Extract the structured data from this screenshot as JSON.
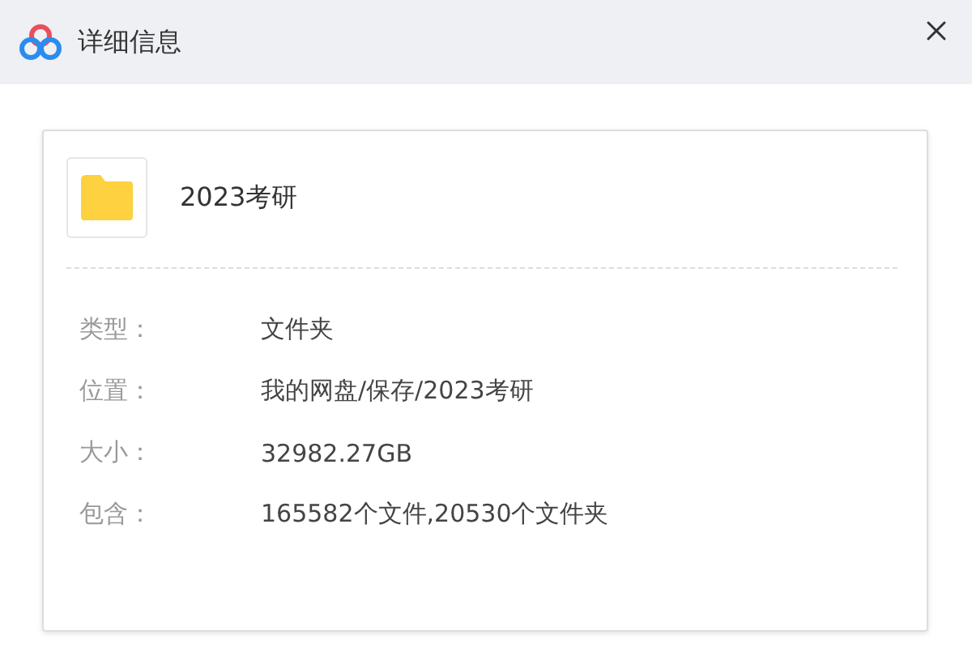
{
  "window": {
    "title": "详细信息"
  },
  "item": {
    "name": "2023考研"
  },
  "details": [
    {
      "label": "类型：",
      "value": "文件夹"
    },
    {
      "label": "位置：",
      "value": "我的网盘/保存/2023考研"
    },
    {
      "label": "大小：",
      "value": "32982.27GB"
    },
    {
      "label": "包含：",
      "value": "165582个文件,20530个文件夹"
    }
  ]
}
